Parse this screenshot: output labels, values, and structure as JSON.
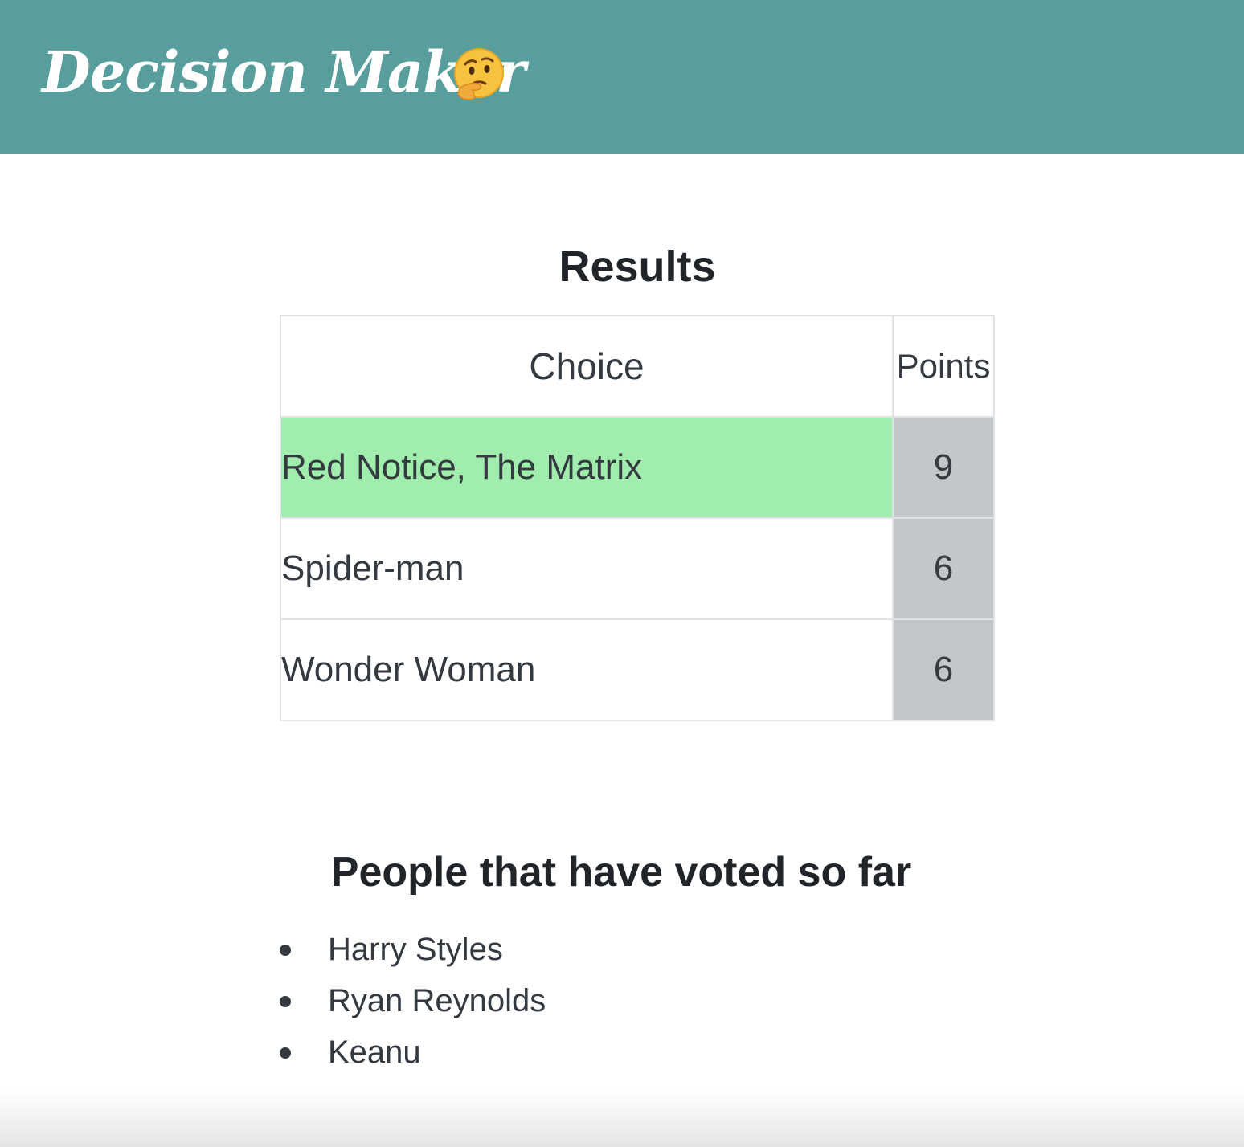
{
  "navbar": {
    "brand": "Decision Maker",
    "emoji_icon": "thinking-face-icon",
    "background": "#579e9c"
  },
  "results": {
    "title": "Results",
    "columns": [
      "Choice",
      "Points"
    ],
    "rows": [
      {
        "choice": "Red Notice, The Matrix",
        "points": "9",
        "winner": true
      },
      {
        "choice": "Spider-man",
        "points": "6",
        "winner": false
      },
      {
        "choice": "Wonder Woman",
        "points": "6",
        "winner": false
      }
    ],
    "colors": {
      "winner_row": "#a1edad",
      "points_cell": "#c4c7c9"
    }
  },
  "voters": {
    "title": "People that have voted so far",
    "names": [
      "Harry Styles",
      "Ryan Reynolds",
      "Keanu"
    ]
  }
}
